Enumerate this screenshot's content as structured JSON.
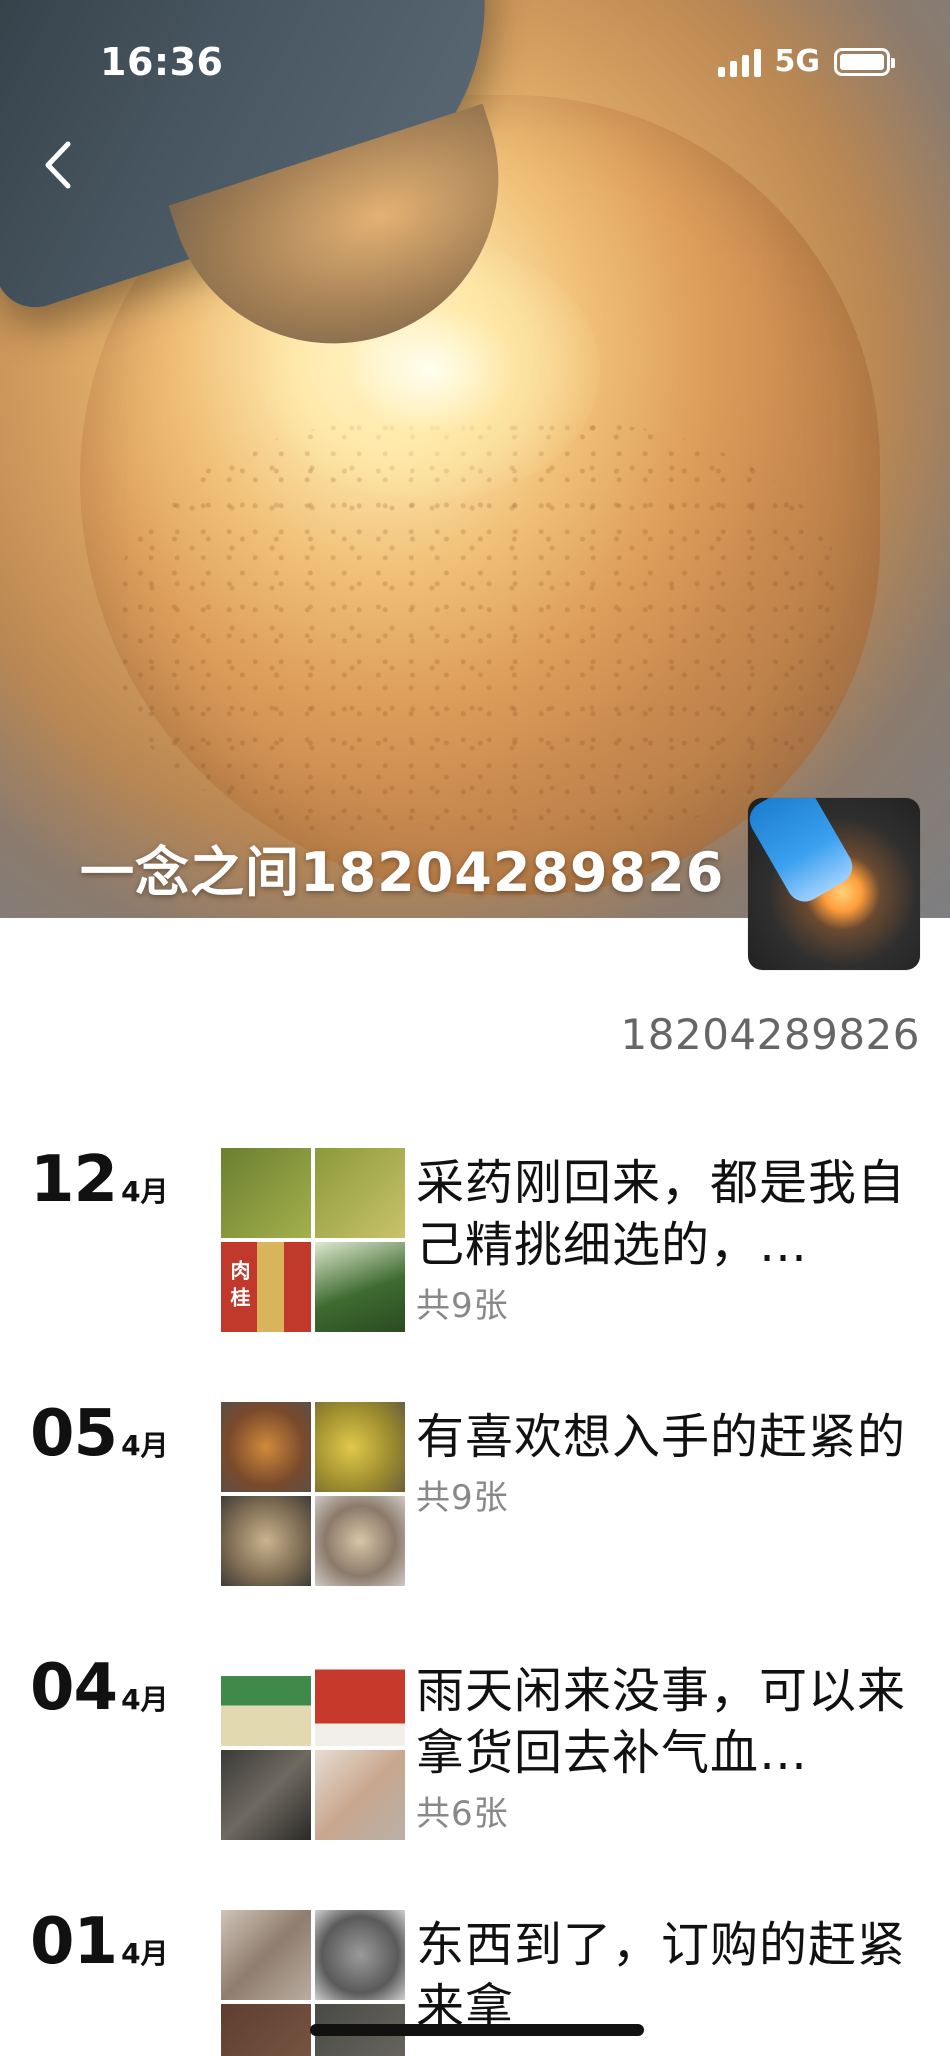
{
  "status_bar": {
    "time": "16:36",
    "network": "5G"
  },
  "profile": {
    "nickname": "一念之间18204289826",
    "signature": "18204289826"
  },
  "colors": {
    "title": "#111111",
    "secondary": "#888888",
    "signature": "#666666",
    "background": "#ffffff"
  },
  "posts": [
    {
      "day": "12",
      "month": "4月",
      "text": "采药刚回来，都是我自己精挑细选的，…",
      "count": "共9张",
      "thumbs": [
        {
          "name": "herb-field-photo",
          "color": "#7a8f3a",
          "label": ""
        },
        {
          "name": "herb-vines-photo",
          "color": "#a7b24a",
          "label": ""
        },
        {
          "name": "cinnamon-bag-photo",
          "color": "#b6452c",
          "label": "肉 桂"
        },
        {
          "name": "seedling-photo",
          "color": "#3e6b2f",
          "label": ""
        }
      ]
    },
    {
      "day": "05",
      "month": "4月",
      "text": "有喜欢想入手的赶紧的",
      "count": "共9张",
      "thumbs": [
        {
          "name": "stone-photo-1",
          "color": "#8c5a3c",
          "label": ""
        },
        {
          "name": "stone-photo-2",
          "color": "#b9a23a",
          "label": ""
        },
        {
          "name": "stone-photo-3",
          "color": "#7c6a52",
          "label": ""
        },
        {
          "name": "stone-photo-4",
          "color": "#8b7a6a",
          "label": ""
        }
      ]
    },
    {
      "day": "04",
      "month": "4月",
      "text": "雨天闲来没事，可以来拿货回去补气血…",
      "count": "共6张",
      "thumbs": [
        {
          "name": "tea-package-photo",
          "color": "#4f8c4e",
          "label": ""
        },
        {
          "name": "red-package-photo",
          "color": "#c73a2b",
          "label": ""
        },
        {
          "name": "dried-herb-bag-photo",
          "color": "#4a4a48",
          "label": ""
        },
        {
          "name": "ginseng-bag-photo",
          "color": "#c9b7a8",
          "label": ""
        }
      ]
    },
    {
      "day": "01",
      "month": "4月",
      "text": "东西到了，订购的赶紧来拿",
      "count": "",
      "thumbs": [
        {
          "name": "ginseng-photo",
          "color": "#a89a8e",
          "label": ""
        },
        {
          "name": "stone-photo-5",
          "color": "#6f6f6f",
          "label": ""
        },
        {
          "name": "grain-photo",
          "color": "#6b4a3a",
          "label": ""
        },
        {
          "name": "misc-photo",
          "color": "#5a5a56",
          "label": ""
        }
      ]
    }
  ]
}
